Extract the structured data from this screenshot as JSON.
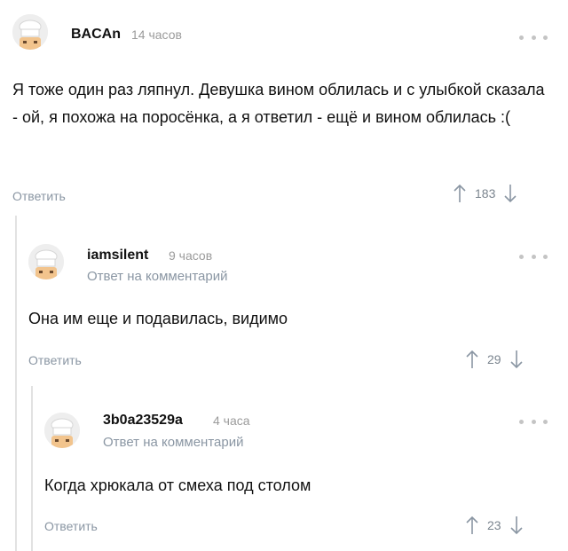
{
  "comments": [
    {
      "username": "BACAn",
      "time": "14 часов",
      "text": "Я тоже один раз ляпнул. Девушка вином облилась и с улыбкой сказала - ой, я похожа на поросёнка, а я ответил - ещё и вином облилась :(",
      "reply_label": "Ответить",
      "score": "183"
    },
    {
      "username": "iamsilent",
      "time": "9 часов",
      "reply_to": "Ответ на комментарий",
      "text": "Она им еще и подавилась, видимо",
      "reply_label": "Ответить",
      "score": "29"
    },
    {
      "username": "3b0a23529a",
      "time": "4 часа",
      "reply_to": "Ответ на комментарий",
      "text": "Когда хрюкала от смеха под столом",
      "reply_label": "Ответить",
      "score": "23"
    }
  ],
  "icons": {
    "avatar": "chef-avatar-icon",
    "more": "more-dots-icon",
    "upvote": "arrow-up-icon",
    "downvote": "arrow-down-icon"
  },
  "colors": {
    "meta": "#8a96a3",
    "time": "#9b9b9b",
    "thread_line": "#e2e2e2"
  }
}
